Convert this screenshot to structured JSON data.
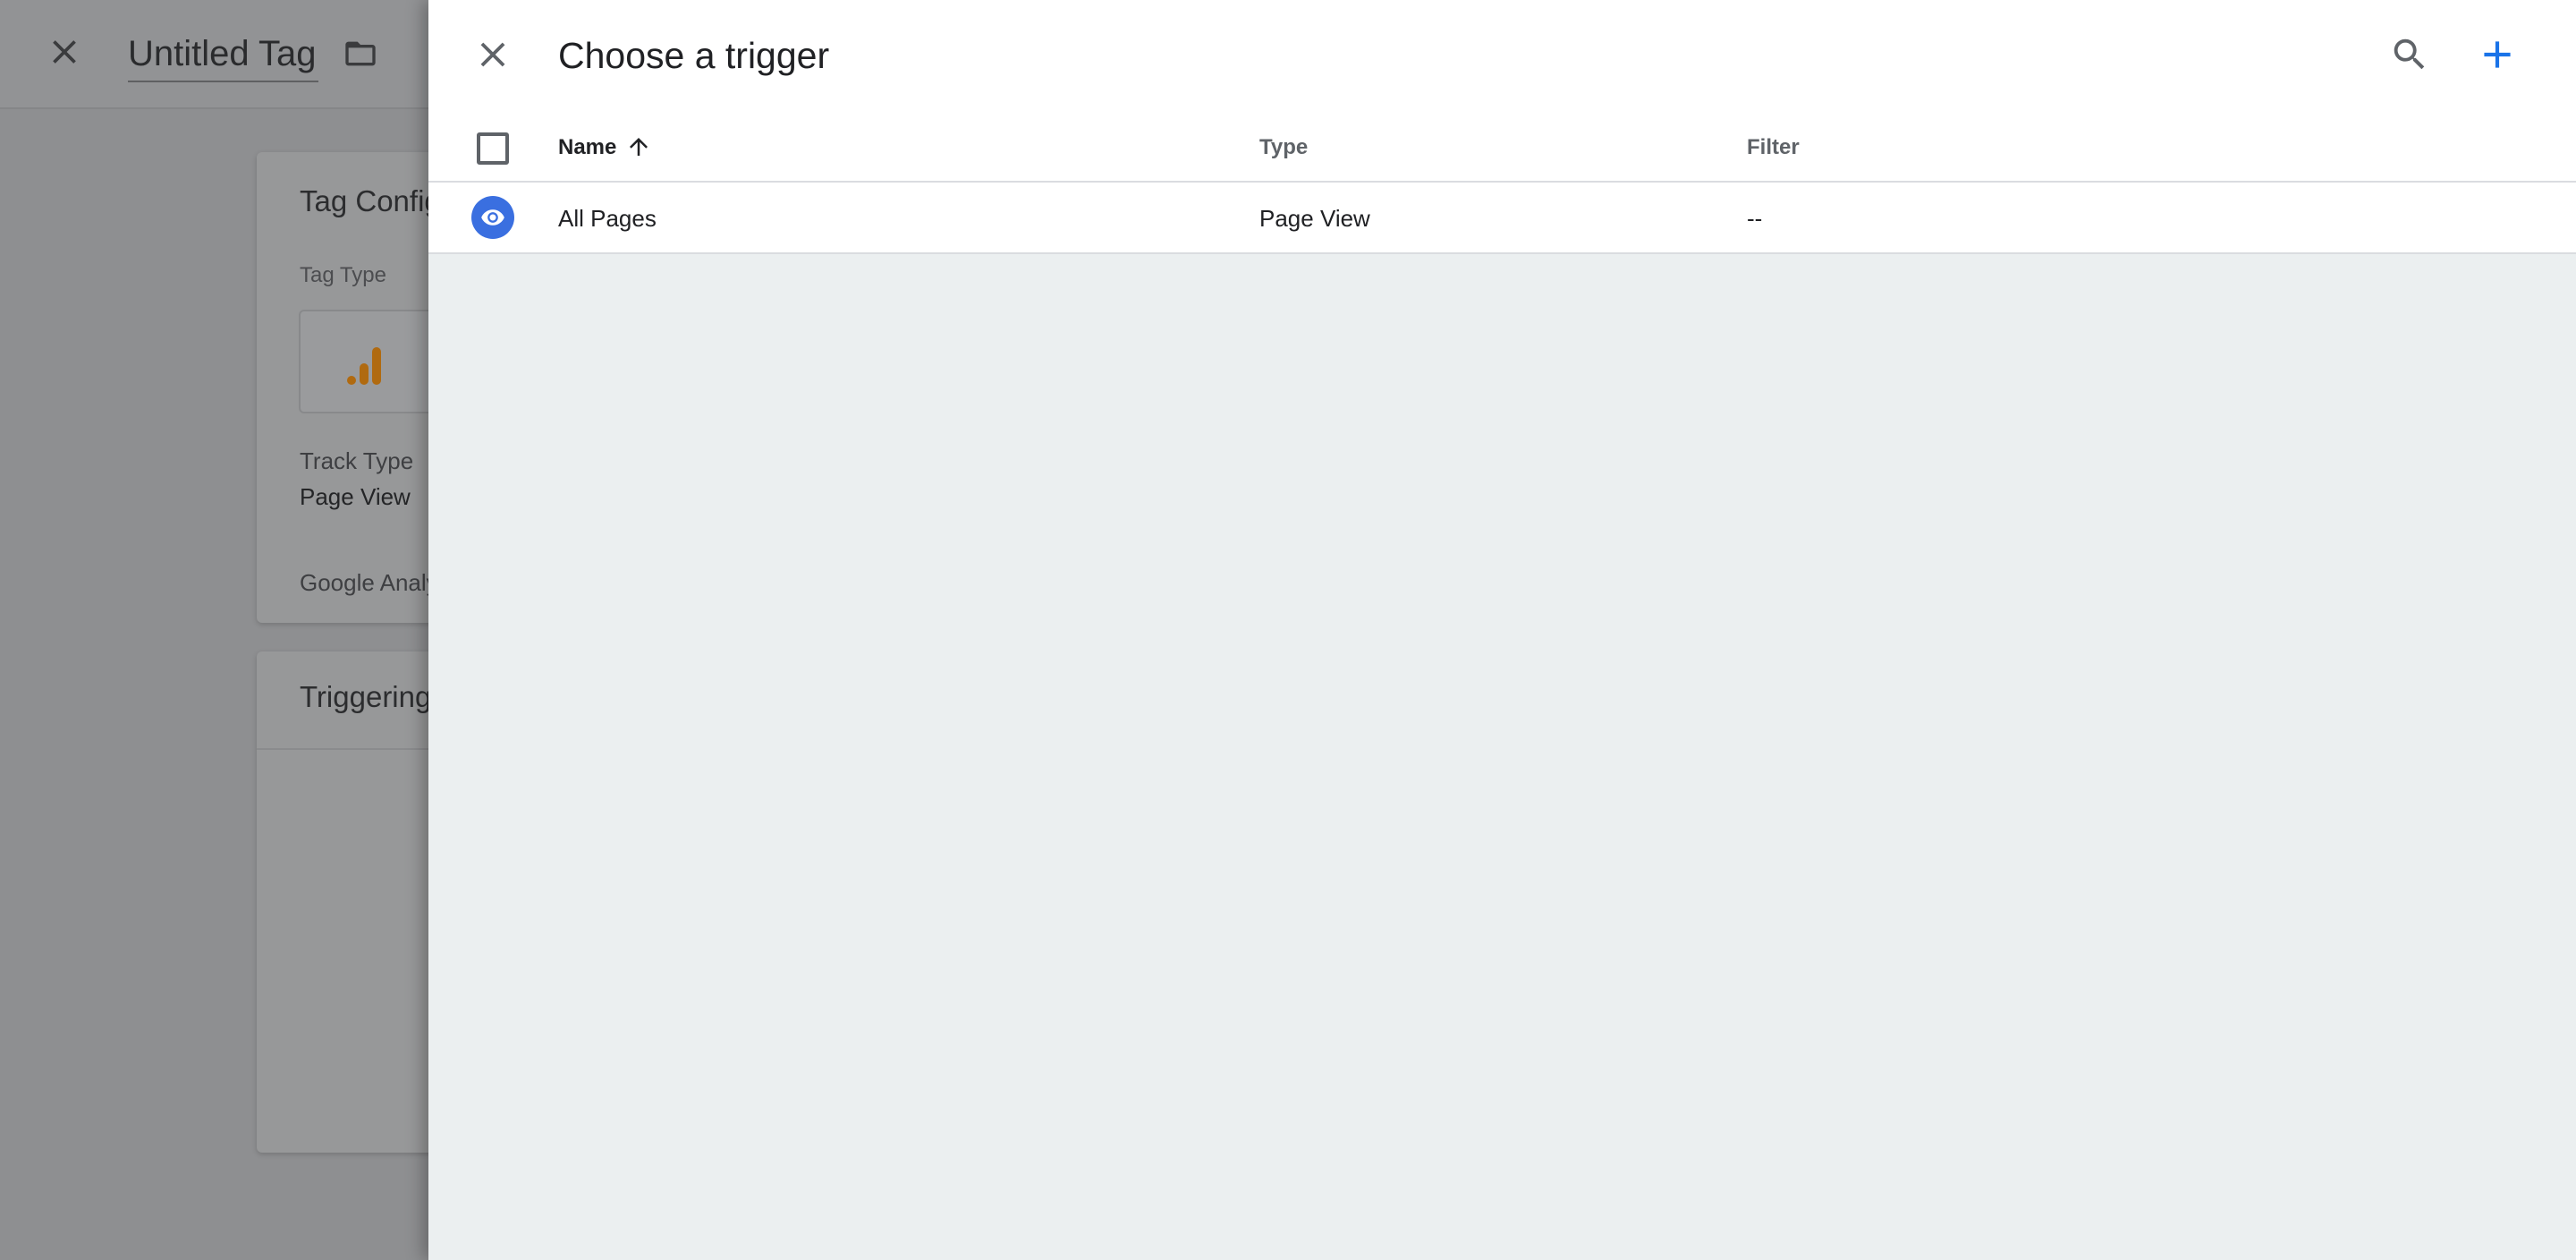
{
  "background_editor": {
    "tag_title": "Untitled Tag",
    "config_card": {
      "title": "Tag Configuration",
      "tag_type_label": "Tag Type",
      "track_type_label": "Track Type",
      "track_type_value": "Page View",
      "ga_settings_label": "Google Analytics Settings"
    },
    "triggering_card": {
      "title": "Triggering"
    }
  },
  "trigger_panel": {
    "title": "Choose a trigger",
    "columns": {
      "name": "Name",
      "type": "Type",
      "filter": "Filter"
    },
    "rows": [
      {
        "name": "All Pages",
        "type": "Page View",
        "filter": "--",
        "icon": "eye-icon"
      }
    ]
  },
  "colors": {
    "accent_blue": "#1a73e8",
    "row_icon_blue": "#3a6fe0",
    "ga_orange": "#b06a10"
  }
}
